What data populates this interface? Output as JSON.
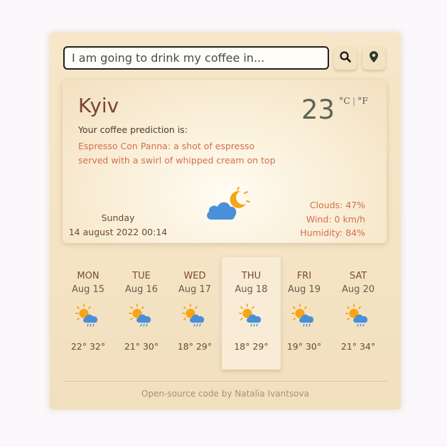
{
  "search": {
    "placeholder": "I am going to drink my coffee in...",
    "search_icon": "search-icon",
    "location_icon": "map-pin-icon"
  },
  "current": {
    "city": "Kyiv",
    "prediction_label": "Your coffee prediction is:",
    "prediction": "Espresso Con Panna: a shot of espresso served with a swirl of whipped cream on top",
    "temperature": "23",
    "unit_c": "°C",
    "unit_sep": "|",
    "unit_f": "°F",
    "day": "Sunday",
    "date": "14 august 2022 00:14",
    "icon": "partly-cloudy-night-icon",
    "clouds": "Clouds: 47%",
    "wind": "Wind: 0 km/h",
    "humidity": "Humidity: 84%"
  },
  "forecast": [
    {
      "day": "MON",
      "date": "Aug 15",
      "temps": "22° 32°",
      "icon": "sun-rain-icon"
    },
    {
      "day": "TUE",
      "date": "Aug 16",
      "temps": "21° 30°",
      "icon": "sun-rain-icon"
    },
    {
      "day": "WED",
      "date": "Aug 17",
      "temps": "18° 29°",
      "icon": "sun-rain-icon"
    },
    {
      "day": "THU",
      "date": "Aug 18",
      "temps": "18° 29°",
      "icon": "sun-rain-icon",
      "selected": true
    },
    {
      "day": "FRI",
      "date": "Aug 19",
      "temps": "19° 30°",
      "icon": "sun-rain-icon"
    },
    {
      "day": "SAT",
      "date": "Aug 20",
      "temps": "21° 34°",
      "icon": "sun-rain-icon"
    }
  ],
  "footer": {
    "text": "Open-source code  by  Natalia Ivantsova"
  },
  "colors": {
    "accent": "#d56e4b",
    "city": "#7a4433",
    "background": "#f4e4c4"
  }
}
